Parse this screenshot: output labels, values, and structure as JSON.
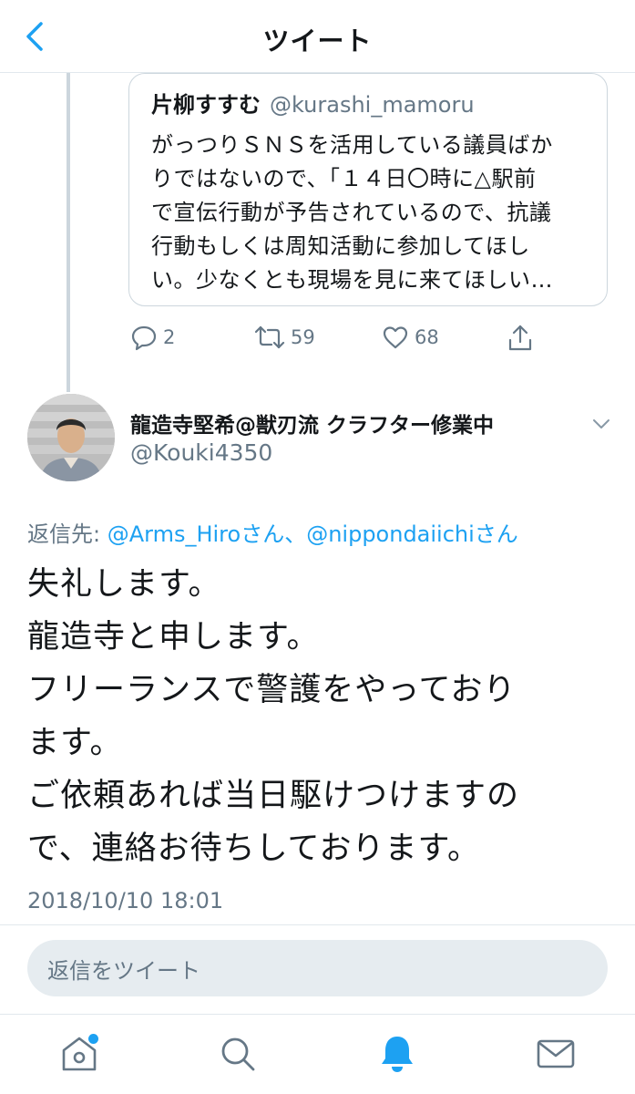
{
  "header": {
    "title": "ツイート"
  },
  "quoted_tweet": {
    "name": "片柳すすむ",
    "handle": "@kurashi_mamoru",
    "lines": [
      "がっつりＳＮＳを活用している議員ばか",
      "りではないので、「１４日〇時に△駅前",
      "で宣伝行動が予告されているので、抗議",
      "行動もしくは周知活動に参加してほし",
      "い。少なくとも現場を見に来てほしい…"
    ]
  },
  "actions": {
    "replies": "2",
    "retweets": "59",
    "likes": "68"
  },
  "tweet": {
    "author_name": "龍造寺堅希@獣刃流 クラフター修業中",
    "author_handle": "@Kouki4350",
    "reply_prefix": "返信先: ",
    "reply_user_1": "@Arms_Hiro",
    "reply_sep": "さん、",
    "reply_user_2": "@nippondaiichi",
    "reply_suffix": "さん",
    "lines": [
      "失礼します。",
      "龍造寺と申します。",
      "フリーランスで警護をやっており",
      "ます。",
      "ご依頼あれば当日駆けつけますの",
      "で、連絡お待ちしております。"
    ],
    "timestamp": "2018/10/10 18:01"
  },
  "reply_box": {
    "placeholder": "返信をツイート"
  },
  "colors": {
    "accent": "#1da1f2",
    "muted": "#657786",
    "text": "#14171a",
    "border": "#e1e8ed"
  },
  "icons": [
    "back-chevron-icon",
    "reply-icon",
    "retweet-icon",
    "like-icon",
    "share-icon",
    "caret-down-icon",
    "home-icon",
    "search-icon",
    "notifications-icon",
    "messages-icon"
  ]
}
